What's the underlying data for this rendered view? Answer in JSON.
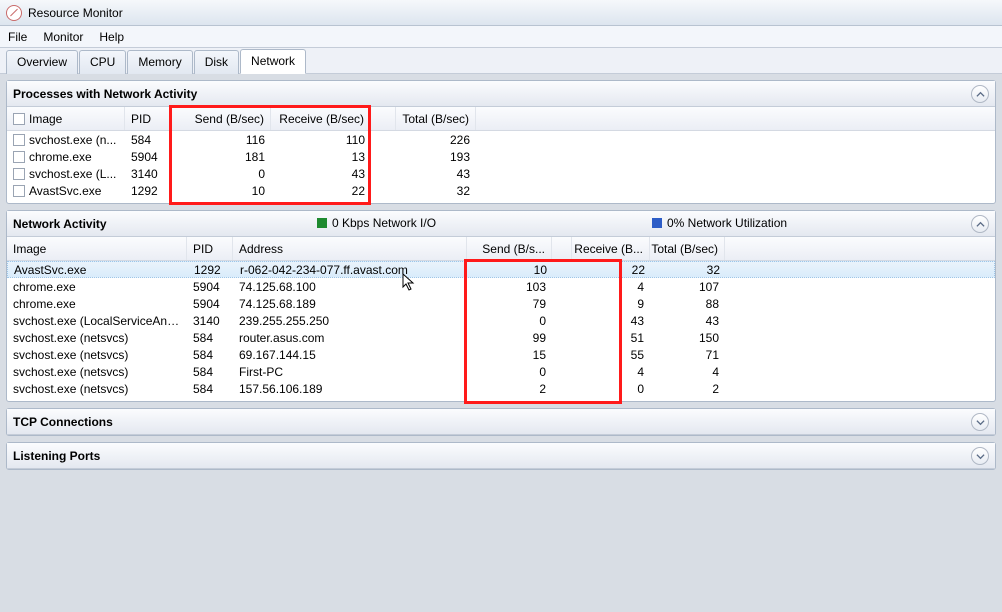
{
  "window": {
    "title": "Resource Monitor"
  },
  "menu": {
    "file": "File",
    "monitor": "Monitor",
    "help": "Help"
  },
  "tabs": {
    "overview": "Overview",
    "cpu": "CPU",
    "memory": "Memory",
    "disk": "Disk",
    "network": "Network"
  },
  "panel_processes": {
    "title": "Processes with Network Activity",
    "columns": {
      "image": "Image",
      "pid": "PID",
      "send": "Send (B/sec)",
      "receive": "Receive (B/sec)",
      "total": "Total (B/sec)"
    },
    "rows": [
      {
        "image": "svchost.exe (n...",
        "pid": "584",
        "send": "116",
        "receive": "110",
        "total": "226"
      },
      {
        "image": "chrome.exe",
        "pid": "5904",
        "send": "181",
        "receive": "13",
        "total": "193"
      },
      {
        "image": "svchost.exe (L...",
        "pid": "3140",
        "send": "0",
        "receive": "43",
        "total": "43"
      },
      {
        "image": "AvastSvc.exe",
        "pid": "1292",
        "send": "10",
        "receive": "22",
        "total": "32"
      }
    ]
  },
  "panel_activity": {
    "title": "Network Activity",
    "status_io": "0 Kbps Network I/O",
    "status_util": "0% Network Utilization",
    "columns": {
      "image": "Image",
      "pid": "PID",
      "address": "Address",
      "send": "Send (B/s...",
      "receive": "Receive (B...",
      "total": "Total (B/sec)"
    },
    "rows": [
      {
        "image": "AvastSvc.exe",
        "pid": "1292",
        "address": "r-062-042-234-077.ff.avast.com",
        "send": "10",
        "receive": "22",
        "total": "32",
        "selected": true
      },
      {
        "image": "chrome.exe",
        "pid": "5904",
        "address": "74.125.68.100",
        "send": "103",
        "receive": "4",
        "total": "107"
      },
      {
        "image": "chrome.exe",
        "pid": "5904",
        "address": "74.125.68.189",
        "send": "79",
        "receive": "9",
        "total": "88"
      },
      {
        "image": "svchost.exe (LocalServiceAndNo...",
        "pid": "3140",
        "address": "239.255.255.250",
        "send": "0",
        "receive": "43",
        "total": "43"
      },
      {
        "image": "svchost.exe (netsvcs)",
        "pid": "584",
        "address": "router.asus.com",
        "send": "99",
        "receive": "51",
        "total": "150"
      },
      {
        "image": "svchost.exe (netsvcs)",
        "pid": "584",
        "address": "69.167.144.15",
        "send": "15",
        "receive": "55",
        "total": "71"
      },
      {
        "image": "svchost.exe (netsvcs)",
        "pid": "584",
        "address": "First-PC",
        "send": "0",
        "receive": "4",
        "total": "4"
      },
      {
        "image": "svchost.exe (netsvcs)",
        "pid": "584",
        "address": "157.56.106.189",
        "send": "2",
        "receive": "0",
        "total": "2"
      }
    ]
  },
  "panel_tcp": {
    "title": "TCP Connections"
  },
  "panel_listen": {
    "title": "Listening Ports"
  }
}
